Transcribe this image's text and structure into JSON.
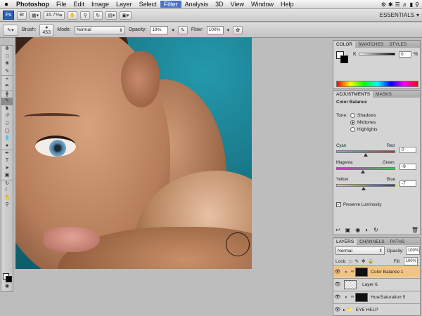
{
  "menubar": {
    "apple": "",
    "items": [
      "Photoshop",
      "File",
      "Edit",
      "Image",
      "Layer",
      "Select",
      "Filter",
      "Analysis",
      "3D",
      "View",
      "Window",
      "Help"
    ],
    "active_index": 6
  },
  "appbar": {
    "logo": "Ps",
    "zoom": "16.7%",
    "workspace": "ESSENTIALS"
  },
  "options": {
    "brush_label": "Brush:",
    "brush_size": "453",
    "mode_label": "Mode:",
    "mode_value": "Normal",
    "opacity_label": "Opacity:",
    "opacity_value": "19%",
    "flow_label": "Flow:",
    "flow_value": "100%"
  },
  "color_panel": {
    "tabs": [
      "COLOR",
      "SWATCHES",
      "STYLES"
    ],
    "k_label": "K",
    "k_value": "0",
    "k_unit": "%"
  },
  "adjustments": {
    "tabs": [
      "ADJUSTMENTS",
      "MASKS"
    ],
    "title": "Color Balance",
    "tone_label": "Tone:",
    "tones": [
      "Shadows",
      "Midtones",
      "Highlights"
    ],
    "tone_selected": 1,
    "sliders": [
      {
        "left": "Cyan",
        "right": "Red",
        "value": "0",
        "level": 0.5
      },
      {
        "left": "Magenta",
        "right": "Green",
        "value": "-9",
        "level": 0.45
      },
      {
        "left": "Yellow",
        "right": "Blue",
        "value": "-7",
        "level": 0.46
      }
    ],
    "preserve_label": "Preserve Luminosity"
  },
  "layers": {
    "tabs": [
      "LAYERS",
      "CHANNELS",
      "PATHS"
    ],
    "blend": "Normal",
    "opacity_label": "Opacity:",
    "opacity_value": "100%",
    "lock_label": "Lock:",
    "fill_label": "Fill:",
    "fill_value": "100%",
    "rows": [
      {
        "name": "Color Balance 1",
        "selected": true
      },
      {
        "name": "Layer 6",
        "selected": false
      },
      {
        "name": "Hue/Saturation 5",
        "selected": false
      },
      {
        "name": "EYE HELP",
        "selected": false
      }
    ]
  }
}
